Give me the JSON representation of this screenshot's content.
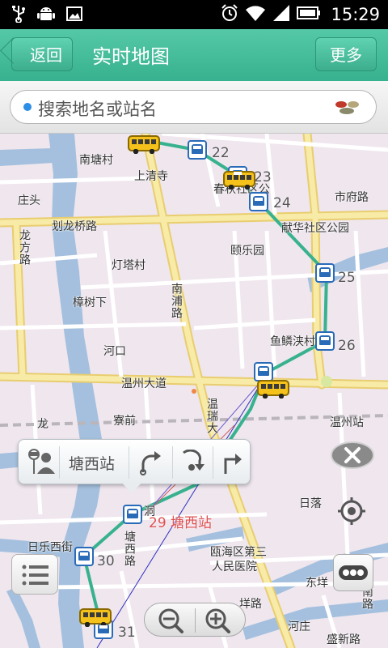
{
  "status_bar": {
    "time": "15:29"
  },
  "header": {
    "back_label": "返回",
    "title": "实时地图",
    "more_label": "更多"
  },
  "search": {
    "placeholder": "搜索地名或站名"
  },
  "map": {
    "place_labels": {
      "nantang_village": "南塘村",
      "shangqingsi": "上清寺",
      "zhuangtou": "庄头",
      "chunqiu_community": "春秋社区公",
      "shiqian_road": "市府路",
      "xianhua_community": "献华社区公园",
      "hualongqiao_road": "划龙桥路",
      "longfang_road": "龙方路",
      "dengta_village": "灯塔村",
      "yile_garden": "颐乐园",
      "nanpu_road": "南浦路",
      "zhangshuxia": "樟树下",
      "yulinmo": "鱼鳞浃村",
      "hekou": "河口",
      "wenzhou_avenue": "温州大道",
      "lan": "龙",
      "jianqian": "寮前",
      "wenrui": "温瑞大",
      "wenzhou_station": "温州站",
      "riluo": "日落",
      "yuehaiqu": "瓯海区第三",
      "peoples_hospital": "人民医院",
      "riluoxijie": "日乐西街",
      "tangxi_road": "塘西路",
      "dongzhu": "东垟",
      "xiangzhu_road": "垟路",
      "hezhuang": "河庄",
      "shengxin_road": "盛新路",
      "nan_road": "南路",
      "dong": "洞"
    },
    "stop_numbers": {
      "s22": "22",
      "s23": "23",
      "s24": "24",
      "s25": "25",
      "s26": "26",
      "s30": "30",
      "s31": "31"
    },
    "selected_stop_label": "29 塘西站",
    "popup": {
      "station_name": "塘西站"
    }
  },
  "icons": [
    "usb-icon",
    "android-debug-icon",
    "image-icon",
    "alarm-icon",
    "wifi-icon",
    "signal-icon",
    "battery-icon",
    "search-dot-icon",
    "layer-switch-icon",
    "person-stop-icon",
    "route-start-icon",
    "route-via-icon",
    "route-end-icon",
    "close-icon",
    "locate-icon",
    "traffic-light-icon",
    "list-icon",
    "zoom-out-icon",
    "zoom-in-icon",
    "bus-icon",
    "bus-stop-icon"
  ],
  "colors": {
    "header": "#3fb896",
    "route": "#38b28e",
    "bus_stop": "#2a6bb8",
    "bus": "#f5c21b",
    "selected_stop_text": "#e05050"
  }
}
